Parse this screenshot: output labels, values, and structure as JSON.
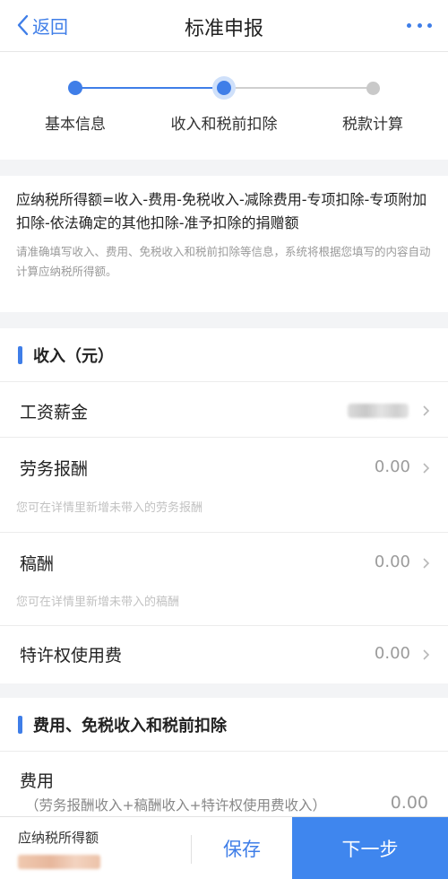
{
  "nav": {
    "back_label": "返回",
    "title": "标准申报",
    "more_icon": "more-icon"
  },
  "steps": [
    {
      "label": "基本信息",
      "state": "done"
    },
    {
      "label": "收入和税前扣除",
      "state": "active"
    },
    {
      "label": "税款计算",
      "state": "pending"
    }
  ],
  "formula": {
    "main": "应纳税所得额=收入-费用-免税收入-减除费用-专项扣除-专项附加扣除-依法确定的其他扣除-准予扣除的捐赠额",
    "hint": "请准确填写收入、费用、免税收入和税前扣除等信息，系统将根据您填写的内容自动计算应纳税所得额。"
  },
  "income": {
    "title": "收入（元）",
    "rows": [
      {
        "label": "工资薪金",
        "value": "",
        "hint": ""
      },
      {
        "label": "劳务报酬",
        "value": "0.00",
        "hint": "您可在详情里新增未带入的劳务报酬"
      },
      {
        "label": "稿酬",
        "value": "0.00",
        "hint": "您可在详情里新增未带入的稿酬"
      },
      {
        "label": "特许权使用费",
        "value": "0.00",
        "hint": ""
      }
    ]
  },
  "deductions": {
    "title": "费用、免税收入和税前扣除",
    "fee": {
      "label": "费用",
      "formula": "（劳务报酬收入+稿酬收入+特许权使用费收入）",
      "value": "0.00"
    }
  },
  "footer": {
    "label": "应纳税所得额",
    "save": "保存",
    "next": "下一步"
  },
  "colors": {
    "accent": "#3f7ee8",
    "button": "#3f86ee",
    "pending": "#c9c9c9"
  }
}
